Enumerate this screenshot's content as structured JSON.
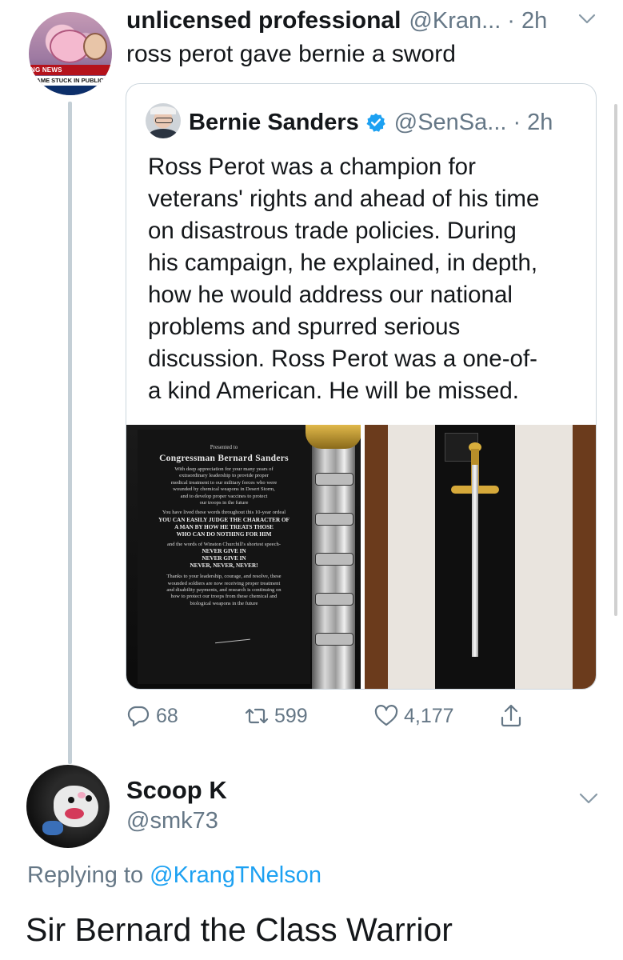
{
  "tweet": {
    "avatar_icon": "news-parody-avatar",
    "avatar_banner_top": "NG NEWS",
    "avatar_banner_mid": "CAME STUCK IN PUBLIC TOI",
    "display_name": "unlicensed professional",
    "handle": "@Kran...",
    "time": "· 2h",
    "text": "ross perot gave bernie a sword"
  },
  "quote": {
    "display_name": "Bernie Sanders",
    "verified_icon": "verified-badge-icon",
    "handle": "@SenSa...",
    "time": "· 2h",
    "text_lines": [
      "Ross Perot was a champion for",
      "veterans' rights and ahead of his time",
      "on disastrous trade policies. During",
      "his campaign, he explained, in depth,",
      "how he would address our national",
      "problems and spurred serious",
      "discussion. Ross Perot was a one-of-",
      "a kind American. He will be missed."
    ],
    "plaque": {
      "presented": "Presented to",
      "recipient": "Congressman Bernard Sanders",
      "body_lines": [
        "With deep appreciation for your many years of",
        "extraordinary leadership to provide proper",
        "medical treatment to our military forces who were",
        "wounded by chemical weapons in Desert Storm,",
        "and to develop proper vaccines to protect",
        "our troops in the future"
      ],
      "quote_intro": "You have lived these words throughout this 10-year ordeal",
      "bold_lines": [
        "YOU CAN EASILY JUDGE THE CHARACTER OF",
        "A MAN BY HOW HE TREATS THOSE",
        "WHO CAN DO NOTHING FOR HIM"
      ],
      "churchill_intro": "and the words of Winston Churchill's shortest speech-",
      "churchill_lines": [
        "NEVER GIVE IN",
        "NEVER GIVE IN",
        "NEVER, NEVER, NEVER!"
      ],
      "closing_lines": [
        "Thanks to your leadership, courage, and resolve, these",
        "wounded soldiers are now receiving proper treatment",
        "and disability payments, and research is continuing on",
        "how to protect our troops from these chemical and",
        "biological weapons in the future"
      ]
    }
  },
  "actions": {
    "reply_icon": "reply-icon",
    "reply_count": "68",
    "retweet_icon": "retweet-icon",
    "retweet_count": "599",
    "like_icon": "heart-icon",
    "like_count": "4,177",
    "share_icon": "share-icon"
  },
  "reply": {
    "avatar_icon": "opossum-avatar",
    "display_name": "Scoop K",
    "handle": "@smk73",
    "replying_prefix": "Replying to ",
    "replying_to": "@KrangTNelson",
    "text": "Sir Bernard the Class Warrior"
  },
  "colors": {
    "text": "#14171a",
    "secondary": "#657786",
    "link": "#1da1f2",
    "border": "#ccd6dd",
    "thread_line": "#c4cfd6"
  }
}
